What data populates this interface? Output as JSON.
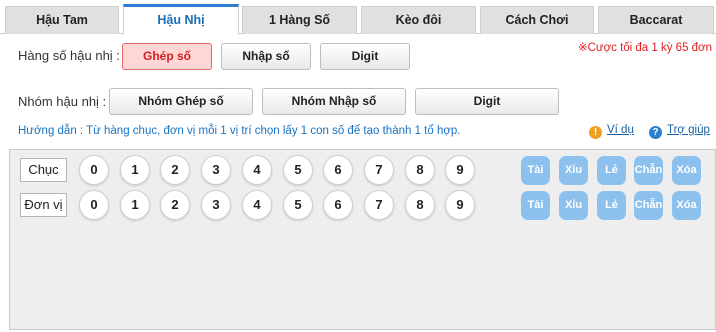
{
  "tabs": [
    "Hậu Tam",
    "Hậu Nhị",
    "1 Hàng Số",
    "Kèo đôi",
    "Cách Chơi",
    "Baccarat"
  ],
  "active_tab": "Hậu Nhị",
  "row1": {
    "label": "Hàng số hậu nhị :",
    "buttons": [
      "Ghép số",
      "Nhập số",
      "Digit"
    ],
    "selected": "Ghép số"
  },
  "bet_limit": "※Cược tối đa 1 kỳ 65 đơn",
  "row2": {
    "label": "Nhóm hậu nhị :",
    "buttons": [
      "Nhóm Ghép số",
      "Nhóm Nhập số",
      "Digit"
    ]
  },
  "guide": "Hướng dẫn : Từ hàng chục, đơn vị mỗi 1 vị trí chọn lấy 1 con số để tạo thành 1 tổ hợp.",
  "help_links": {
    "example": {
      "label": "Ví dụ",
      "icon": "exclamation-icon",
      "color": "#f0a020"
    },
    "help": {
      "label": "Trợ giúp",
      "icon": "question-icon",
      "color": "#2a80d0"
    }
  },
  "positions": [
    {
      "name": "Chục",
      "digits": [
        "0",
        "1",
        "2",
        "3",
        "4",
        "5",
        "6",
        "7",
        "8",
        "9"
      ]
    },
    {
      "name": "Đơn vị",
      "digits": [
        "0",
        "1",
        "2",
        "3",
        "4",
        "5",
        "6",
        "7",
        "8",
        "9"
      ]
    }
  ],
  "quick_buttons": [
    "Tài",
    "Xỉu",
    "Lẻ",
    "Chẵn",
    "Xóa"
  ],
  "colors": {
    "accent": "#2a7fd0",
    "selected_bg": "#ffd6d6",
    "selected_text": "#d02020",
    "quick_bg": "#8cc1ee",
    "limit_text": "#e02020"
  }
}
